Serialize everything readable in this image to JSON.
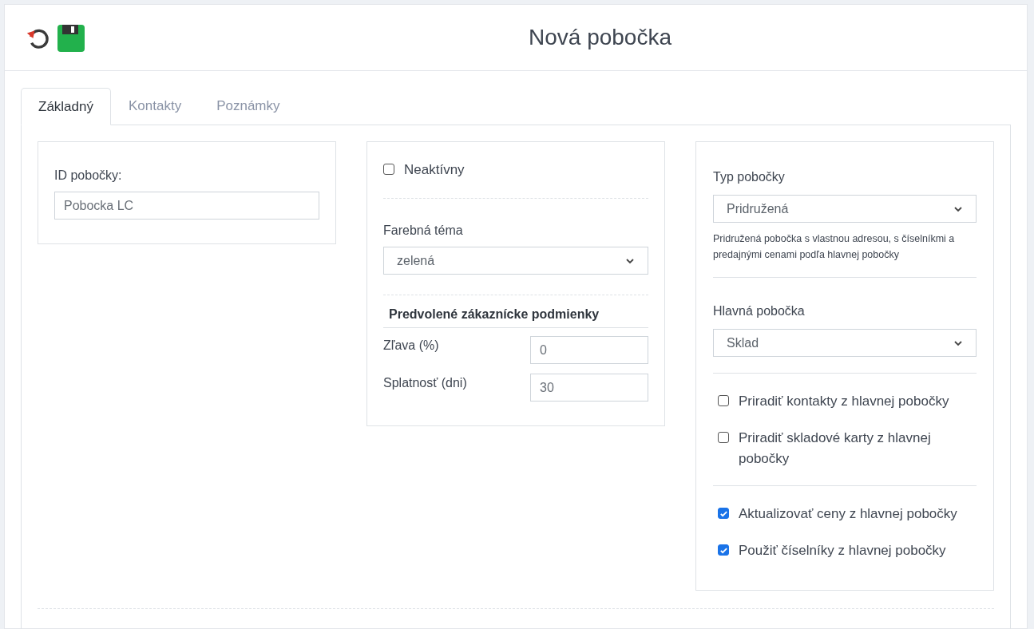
{
  "header": {
    "title": "Nová pobočka"
  },
  "tabs": [
    {
      "label": "Základný",
      "selected": true
    },
    {
      "label": "Kontakty",
      "selected": false
    },
    {
      "label": "Poznámky",
      "selected": false
    }
  ],
  "branch_id": {
    "label": "ID pobočky:",
    "value": "Pobocka LC"
  },
  "inactive": {
    "label": "Neaktívny",
    "checked": false
  },
  "color_theme": {
    "label": "Farebná téma",
    "value": "zelená"
  },
  "default_terms": {
    "heading": "Predvolené zákaznícke podmienky",
    "fields": [
      {
        "label": "Zľava (%)",
        "value": "0"
      },
      {
        "label": "Splatnosť (dni)",
        "value": "30"
      }
    ]
  },
  "branch_type": {
    "label": "Typ pobočky",
    "value": "Pridružená",
    "hint": "Pridružená pobočka s vlastnou adresou, s číselníkmi a predajnými cenami podľa hlavnej pobočky"
  },
  "main_branch": {
    "label": "Hlavná pobočka",
    "value": "Sklad"
  },
  "option_groups": [
    [
      {
        "label": "Priradiť kontakty z hlavnej pobočky",
        "checked": false
      },
      {
        "label": "Priradiť skladové karty z hlavnej pobočky",
        "checked": false
      }
    ],
    [
      {
        "label": "Aktualizovať ceny z hlavnej pobočky",
        "checked": true
      },
      {
        "label": "Použiť číselníky z hlavnej pobočky",
        "checked": true
      }
    ]
  ]
}
